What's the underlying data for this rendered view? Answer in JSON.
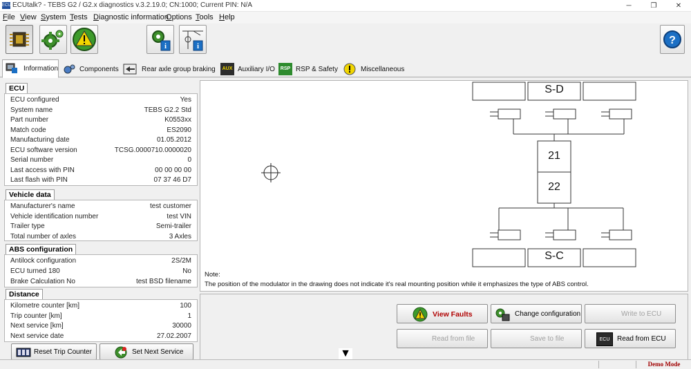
{
  "window": {
    "title": "ECUtalk? - TEBS G2 / G2.x diagnostics v.3.2.19.0; CN:1000; Current PIN: N/A",
    "app_icon_text": "ECU",
    "minimize": "─",
    "maximize": "❐",
    "close": "✕"
  },
  "menu": [
    "File",
    "View",
    "System",
    "Tests",
    "Diagnostic information",
    "Options",
    "Tools",
    "Help"
  ],
  "tabs": [
    {
      "label": "Information",
      "active": true
    },
    {
      "label": "Components",
      "active": false
    },
    {
      "label": "Rear axle group braking",
      "active": false
    },
    {
      "label": "Auxiliary I/O",
      "active": false,
      "icon_text": "AUX"
    },
    {
      "label": "RSP & Safety",
      "active": false,
      "icon_text": "RSP"
    },
    {
      "label": "Miscellaneous",
      "active": false
    }
  ],
  "ecu": {
    "title": "ECU",
    "rows": [
      {
        "label": "ECU configured",
        "value": "Yes"
      },
      {
        "label": "System name",
        "value": "TEBS G2.2 Std"
      },
      {
        "label": "Part number",
        "value": "K0553xx"
      },
      {
        "label": "Match code",
        "value": "ES2090"
      },
      {
        "label": "Manufacturing date",
        "value": "01.05.2012"
      },
      {
        "label": "ECU software version",
        "value": "TCSG.0000710.0000020"
      },
      {
        "label": "Serial number",
        "value": "0"
      },
      {
        "label": "Last access with PIN",
        "value": "00 00 00 00"
      },
      {
        "label": "Last flash with PIN",
        "value": "07 37 46 D7"
      }
    ]
  },
  "vehicle": {
    "title": "Vehicle data",
    "rows": [
      {
        "label": "Manufacturer's name",
        "value": "test customer"
      },
      {
        "label": "Vehicle identification number",
        "value": "test VIN"
      },
      {
        "label": "Trailer type",
        "value": "Semi-trailer"
      },
      {
        "label": "Total number of axles",
        "value": "3 Axles"
      }
    ]
  },
  "abs": {
    "title": "ABS configuration",
    "rows": [
      {
        "label": "Antilock configuration",
        "value": "2S/2M"
      },
      {
        "label": "ECU turned 180",
        "value": "No"
      },
      {
        "label": "Brake Calculation No",
        "value": "test BSD filename"
      }
    ]
  },
  "distance": {
    "title": "Distance",
    "rows": [
      {
        "label": "Kilometre counter [km]",
        "value": "100"
      },
      {
        "label": "Trip counter [km]",
        "value": "1"
      },
      {
        "label": "Next service [km]",
        "value": "30000"
      },
      {
        "label": "Next service date",
        "value": "27.02.2007"
      }
    ]
  },
  "left_buttons": {
    "reset_trip": "Reset Trip Counter",
    "set_next_service": "Set Next Service"
  },
  "diagram": {
    "top_label": "S-D",
    "bottom_label": "S-C",
    "module_top": "21",
    "module_bottom": "22",
    "note_title": "Note:",
    "note_text": "The position of the modulator in the drawing does not indicate it's real mounting position while it emphasizes the type of ABS control."
  },
  "actions": {
    "view_faults": "View Faults",
    "change_configuration": "Change configuration",
    "write_to_ecu": "Write to ECU",
    "read_from_file": "Read from file",
    "save_to_file": "Save to file",
    "read_from_ecu": "Read from ECU",
    "read_from_ecu_icon_text": "ECU"
  },
  "scroll_arrow": "▼",
  "status": {
    "mode": "Demo Mode"
  },
  "colors": {
    "accent_red": "#a00000",
    "warning_yellow": "#f2d600",
    "help_blue": "#1b6fc4"
  }
}
